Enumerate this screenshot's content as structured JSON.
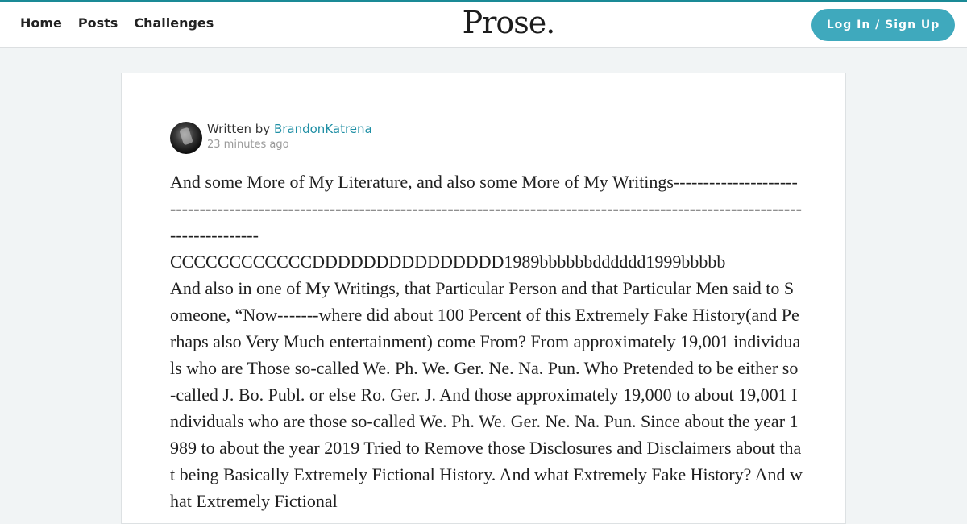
{
  "header": {
    "nav": [
      {
        "label": "Home"
      },
      {
        "label": "Posts"
      },
      {
        "label": "Challenges"
      }
    ],
    "logo": "Prose.",
    "login_label": "Log In / Sign Up",
    "accent_color": "#1a8a96",
    "button_color": "#3fa9bd"
  },
  "post": {
    "written_by_label": "Written by",
    "author": "BrandonKatrena",
    "timestamp": "23 minutes ago",
    "avatar_icon": "user-avatar-photo",
    "body": "And some More of My Literature, and also some More of My Writings-----------------------------------------------------------------------------------------------------------------------------------------------\nCCCCCCCCCCCCDDDDDDDDDDDDDDD1989bbbbbbdddddd1999bbbbb\nAnd also in one of My Writings, that Particular Person and that Particular Men said to Someone, “Now-------where did about 100 Percent of this Extremely Fake History(and Perhaps also Very Much entertainment) come From? From approximately 19,001 individuals who are Those so-called We. Ph. We. Ger. Ne. Na. Pun. Who Pretended to be either so-called J. Bo. Publ. or else Ro. Ger. J. And those approximately 19,000 to about 19,001 Individuals who are those so-called We. Ph. We. Ger. Ne. Na. Pun. Since about the year 1989 to about the year 2019 Tried to Remove those Disclosures and Disclaimers about that being Basically Extremely Fictional History. And what Extremely Fake History? And what Extremely Fictional"
  }
}
